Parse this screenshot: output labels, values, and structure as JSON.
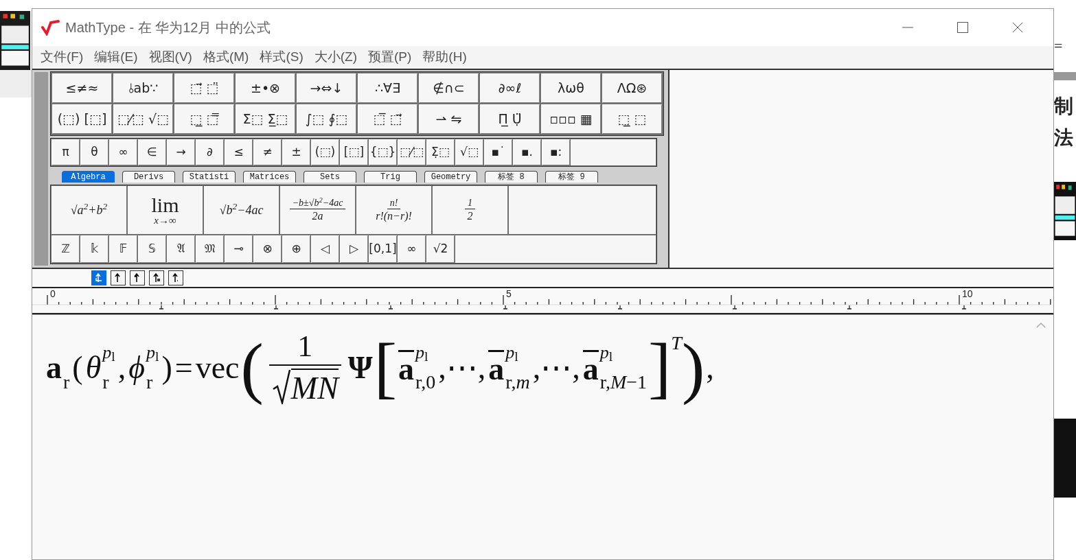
{
  "window": {
    "title": "MathType - 在 华为12月 中的公式"
  },
  "menu": [
    "文件(F)",
    "编辑(E)",
    "视图(V)",
    "格式(M)",
    "样式(S)",
    "大小(Z)",
    "预置(P)",
    "帮助(H)"
  ],
  "palette_rows": [
    [
      "≤≠≈",
      "⫰ab∵",
      "⬚⃗ ⬚̈",
      "±•⊗",
      "→⇔↓",
      "∴∀∃",
      "∉∩⊂",
      "∂∞ℓ",
      "λωθ",
      "ΛΩ⊛"
    ],
    [
      "(⬚) [⬚]",
      "⬚⁄⬚ √⬚",
      "⬚̲ ⬚̿",
      "Σ⬚ Σ̲⬚",
      "∫⬚ ∮⬚",
      "⬚̅ ⬚⃗",
      "⇀ ⇋",
      "Π̲ Ụ̈",
      "▫▫▫ ▦",
      "⬚̲ ⬚"
    ]
  ],
  "symbols": [
    "π",
    "θ",
    "∞",
    "∈",
    "→",
    "∂",
    "≤",
    "≠",
    "±",
    "(⬚)",
    "[⬚]",
    "{⬚}",
    "⬚⁄⬚",
    "Σ̣⬚",
    "√⬚",
    "▪˙",
    "▪.",
    "▪:"
  ],
  "tabs": [
    {
      "label": "Algebra",
      "selected": true
    },
    {
      "label": "Derivs",
      "selected": false
    },
    {
      "label": "Statisti",
      "selected": false
    },
    {
      "label": "Matrices",
      "selected": false
    },
    {
      "label": "Sets",
      "selected": false
    },
    {
      "label": "Trig",
      "selected": false
    },
    {
      "label": "Geometry",
      "selected": false
    },
    {
      "label": "标签 8",
      "selected": false
    },
    {
      "label": "标签 9",
      "selected": false
    }
  ],
  "templates": [
    {
      "kind": "text",
      "text": "√a$^{2}$+b$^{2}$"
    },
    {
      "kind": "limit",
      "top": "lim",
      "bottom": "x→∞"
    },
    {
      "kind": "text",
      "text": "√b$^{2}$−4ac"
    },
    {
      "kind": "frac",
      "num": "−b±√b$^{2}$−4ac",
      "den": "2a"
    },
    {
      "kind": "frac",
      "num": "n!",
      "den": "r!(n−r)!"
    },
    {
      "kind": "frac",
      "num": "1",
      "den": "2"
    }
  ],
  "bottom_symbols": [
    "ℤ",
    "𝕜",
    "𝔽",
    "𝕊",
    "𝔄",
    "𝔐",
    "⊸",
    "⊗",
    "⊕",
    "◁",
    "▷",
    "[0,1]",
    "∞",
    "√2"
  ],
  "nudge_buttons": [
    {
      "selected": true
    },
    {
      "selected": false
    },
    {
      "selected": false
    },
    {
      "selected": false
    },
    {
      "selected": false
    }
  ],
  "ruler": {
    "labels": [
      "0",
      "5",
      "10"
    ]
  },
  "formula": [
    {
      "kind": "script",
      "base": "a",
      "bold": true,
      "sub": "r"
    },
    {
      "kind": "sym",
      "text": "("
    },
    {
      "kind": "script",
      "base": "θ",
      "italic": true,
      "sup": "*p*$_{l}$",
      "sub": "r"
    },
    {
      "kind": "sym",
      "text": ","
    },
    {
      "kind": "script",
      "base": "ϕ",
      "italic": true,
      "sup": "*p*$_{l}$",
      "sub": "r"
    },
    {
      "kind": "sym",
      "text": ")"
    },
    {
      "kind": "sym",
      "text": "="
    },
    {
      "kind": "sym",
      "text": "vec"
    },
    {
      "kind": "big",
      "text": "("
    },
    {
      "kind": "frac",
      "num": "1",
      "den": "*MN*"
    },
    {
      "kind": "sym",
      "text": "Ψ",
      "bold": true
    },
    {
      "kind": "big",
      "text": "["
    },
    {
      "kind": "script",
      "base": "a",
      "bold": true,
      "bar": true,
      "sup": "*p*$_{l}$",
      "sub": "r,0"
    },
    {
      "kind": "sym",
      "text": ",⋯,"
    },
    {
      "kind": "script",
      "base": "a",
      "bold": true,
      "bar": true,
      "sup": "*p*$_{l}$",
      "sub": "r,*m*"
    },
    {
      "kind": "sym",
      "text": ",⋯,"
    },
    {
      "kind": "script",
      "base": "a",
      "bold": true,
      "bar": true,
      "sup": "*p*$_{l}$",
      "sub": "r,*M*−1"
    },
    {
      "kind": "big",
      "text": "]",
      "sup": "*T*"
    },
    {
      "kind": "big",
      "text": ")"
    },
    {
      "kind": "sym",
      "text": ","
    }
  ],
  "background": {
    "texts": [
      "=",
      "制",
      "法"
    ]
  }
}
